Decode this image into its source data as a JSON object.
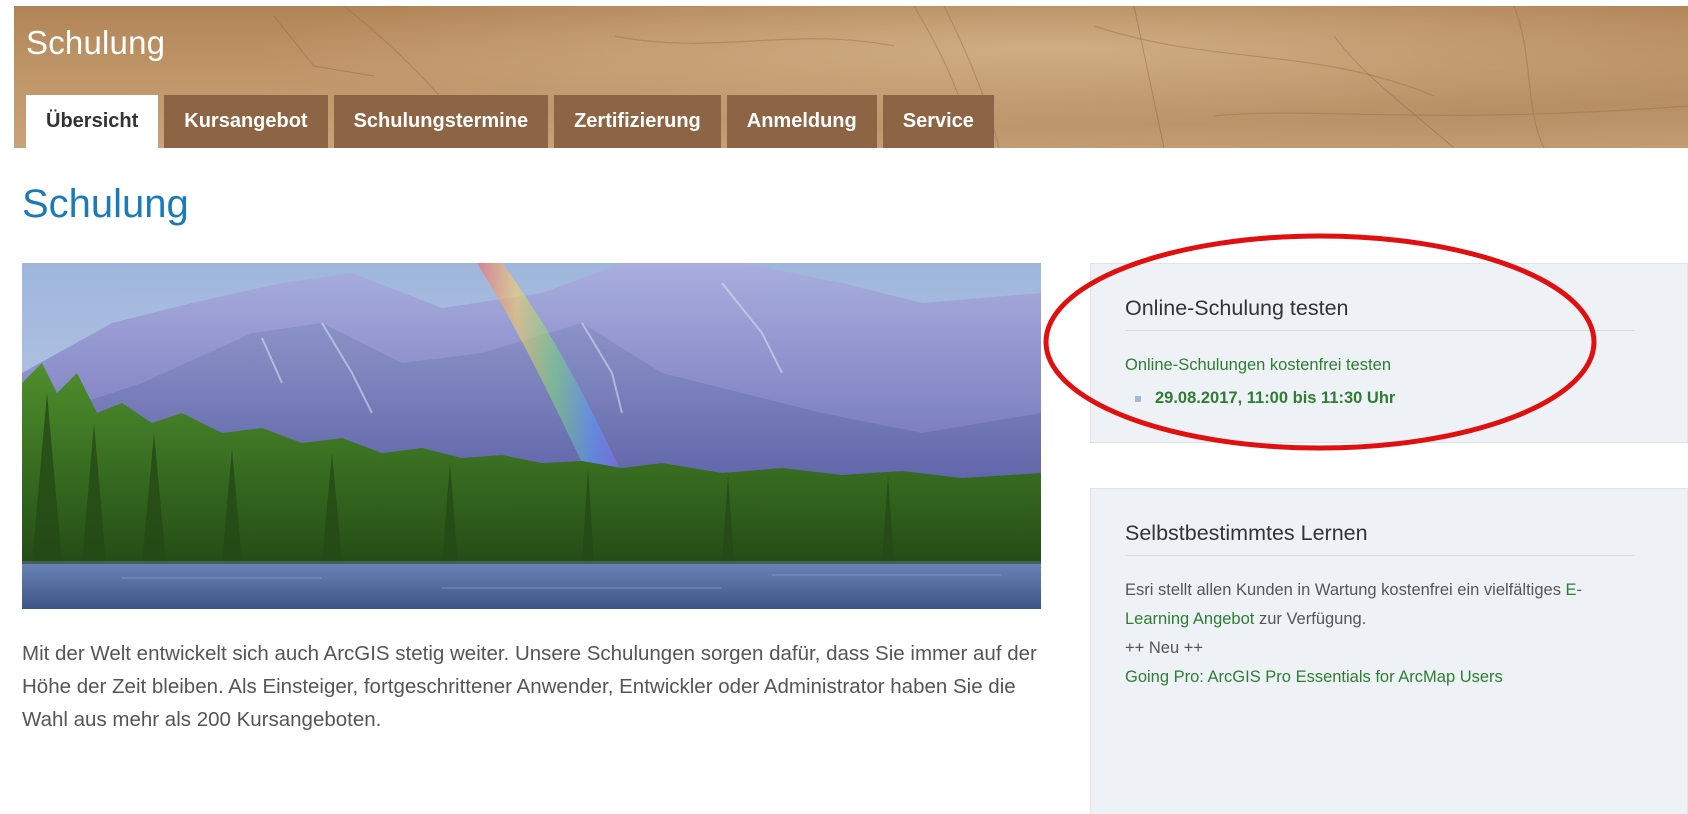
{
  "header": {
    "site_title": "Schulung",
    "tabs": [
      {
        "label": "Übersicht",
        "active": true
      },
      {
        "label": "Kursangebot",
        "active": false
      },
      {
        "label": "Schulungstermine",
        "active": false
      },
      {
        "label": "Zertifizierung",
        "active": false
      },
      {
        "label": "Anmeldung",
        "active": false
      },
      {
        "label": "Service",
        "active": false
      }
    ]
  },
  "main": {
    "page_title": "Schulung",
    "hero_image": "mountain-lake-rainbow-forest",
    "intro_text": "Mit der Welt entwickelt sich auch ArcGIS stetig weiter. Unsere Schulungen sorgen dafür, dass Sie immer auf der Höhe der Zeit bleiben. Als Einsteiger, fortgeschrittener Anwender, Entwickler oder Administrator haben Sie die Wahl aus mehr als 200 Kursangeboten."
  },
  "sidebar": {
    "online_box": {
      "title": "Online-Schulung testen",
      "link": "Online-Schulungen kostenfrei testen",
      "date": "29.08.2017, 11:00 bis 11:30 Uhr"
    },
    "learning_box": {
      "title": "Selbstbestimmtes Lernen",
      "text_before": "Esri stellt allen Kunden in Wartung kostenfrei ein vielfältiges ",
      "link": "E-Learning Angebot",
      "text_after": " zur Verfügung.",
      "new_label": "++ Neu ++",
      "course_link": "Going Pro: ArcGIS Pro Essentials for ArcMap Users"
    }
  },
  "annotation": {
    "shape": "ellipse",
    "color": "#e01010"
  },
  "colors": {
    "header_bg": "#bf9568",
    "tab_bg": "#8d6544",
    "title_blue": "#1b7ab8",
    "link_green": "#2e7d32",
    "sidebar_bg": "#eef2f7"
  }
}
